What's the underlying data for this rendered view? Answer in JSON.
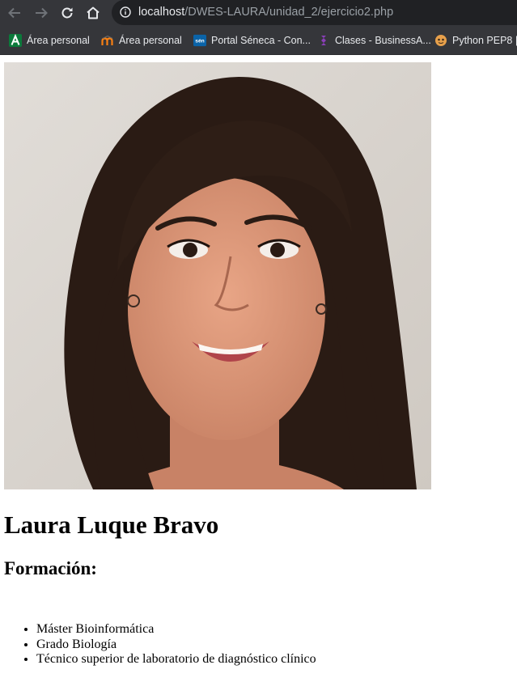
{
  "browser": {
    "url_host": "localhost",
    "url_path": "/DWES-LAURA/unidad_2/ejercicio2.php",
    "bookmarks": [
      {
        "label": "Área personal",
        "icon": "andalucia-green-a-icon"
      },
      {
        "label": "Área personal",
        "icon": "moodle-icon"
      },
      {
        "label": "Portal Séneca - Con...",
        "icon": "seneca-icon"
      },
      {
        "label": "Clases - BusinessA...",
        "icon": "businessa-icon"
      },
      {
        "label": "Python PEP8 |",
        "icon": "python-pep8-icon"
      }
    ],
    "seneca_icon_text": "sén"
  },
  "profile": {
    "photo_alt": "Laura Luque Bravo",
    "name": "Laura Luque Bravo",
    "education_heading": "Formación:",
    "education": [
      "Máster Bioinformática",
      "Grado Biología",
      "Técnico superior de laboratorio de diagnóstico clínico"
    ]
  },
  "colors": {
    "chrome": "#35363a",
    "omnibox": "#202124",
    "page_bg": "#ffffff"
  }
}
